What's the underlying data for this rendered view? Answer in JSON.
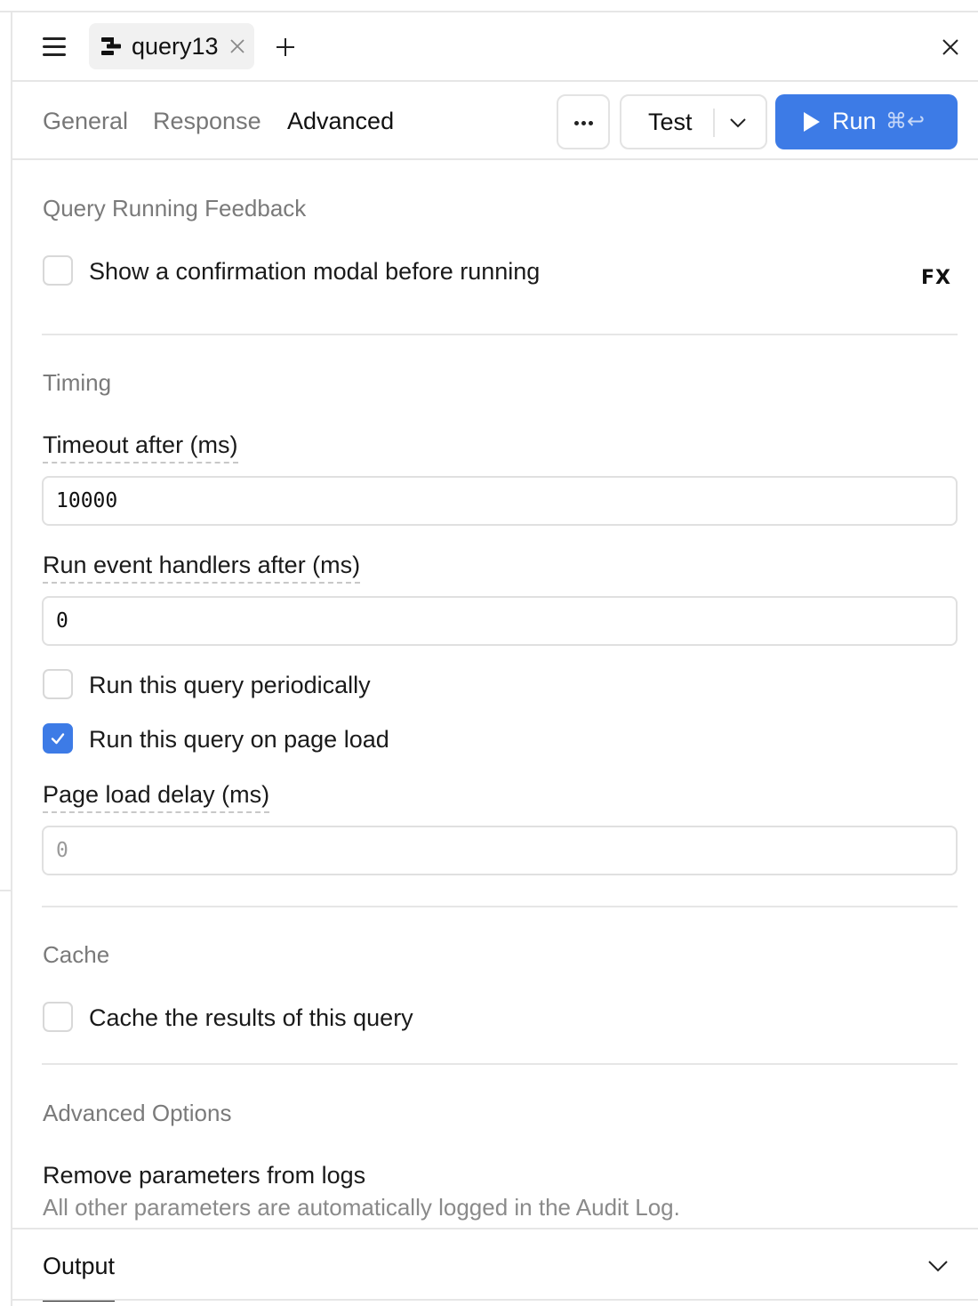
{
  "tab": {
    "name": "query13"
  },
  "section_tabs": [
    {
      "label": "General",
      "active": false
    },
    {
      "label": "Response",
      "active": false
    },
    {
      "label": "Advanced",
      "active": true
    }
  ],
  "toolbar": {
    "test_label": "Test",
    "run_label": "Run",
    "run_shortcut": "⌘↩",
    "more_icon": "ellipsis-icon"
  },
  "query_running_feedback": {
    "heading": "Query Running Feedback",
    "confirm_modal_label": "Show a confirmation modal before running",
    "confirm_modal_checked": false,
    "fx_label": "FX"
  },
  "timing": {
    "heading": "Timing",
    "timeout_label": "Timeout after (ms)",
    "timeout_value": "10000",
    "event_handlers_label": "Run event handlers after (ms)",
    "event_handlers_value": "0",
    "periodic_label": "Run this query periodically",
    "periodic_checked": false,
    "page_load_label": "Run this query on page load",
    "page_load_checked": true,
    "page_load_delay_label": "Page load delay (ms)",
    "page_load_delay_placeholder": "0"
  },
  "cache": {
    "heading": "Cache",
    "cache_results_label": "Cache the results of this query",
    "cache_results_checked": false
  },
  "advanced_options": {
    "heading": "Advanced Options",
    "remove_params_title": "Remove parameters from logs",
    "remove_params_desc": "All other parameters are automatically logged in the Audit Log."
  },
  "output": {
    "label": "Output"
  },
  "colors": {
    "accent": "#3d7be6",
    "muted_text": "#7a7a7a",
    "border": "#e6e6e6"
  }
}
